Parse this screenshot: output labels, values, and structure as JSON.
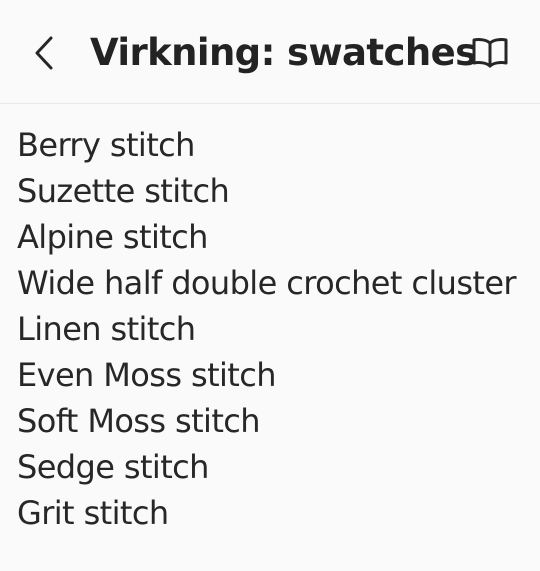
{
  "header": {
    "title": "Virkning: swatches",
    "back_icon": "chevron-left-icon",
    "book_icon": "open-book-icon"
  },
  "items": [
    {
      "label": "Berry stitch"
    },
    {
      "label": "Suzette stitch"
    },
    {
      "label": "Alpine stitch"
    },
    {
      "label": "Wide half double crochet cluster"
    },
    {
      "label": "Linen stitch"
    },
    {
      "label": "Even Moss stitch"
    },
    {
      "label": "Soft Moss stitch"
    },
    {
      "label": "Sedge stitch"
    },
    {
      "label": "Grit stitch"
    }
  ],
  "colors": {
    "background": "#fafafa",
    "text": "#242424",
    "divider": "#e9e9e9"
  }
}
